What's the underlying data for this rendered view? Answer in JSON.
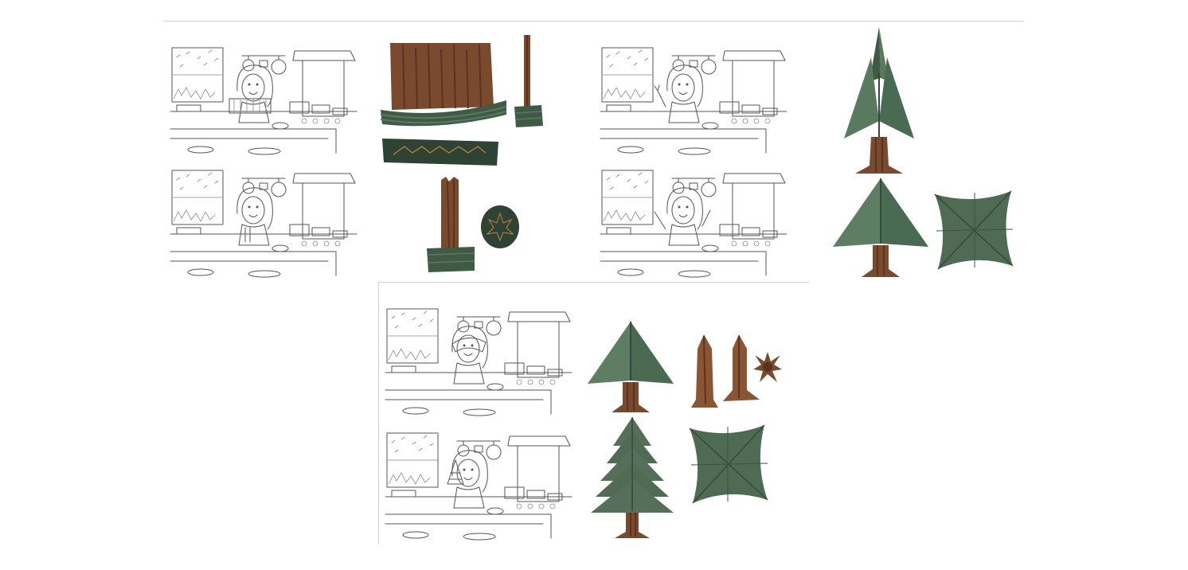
{
  "sheets": [
    {
      "id": "sheet-1",
      "panels": [
        "storyboard-pleat-front",
        "storyboard-pleat-side"
      ],
      "props": [
        "pleated-trunk-paper",
        "folded-base-strip",
        "tall-trunk-stick",
        "short-trunk-stick",
        "star-cut-circle"
      ]
    },
    {
      "id": "sheet-2",
      "panels": [
        "storyboard-wave",
        "storyboard-wave-both-hands"
      ],
      "props": [
        "tall-tree-model",
        "small-tree-model",
        "square-fold-base"
      ]
    },
    {
      "id": "sheet-3",
      "panels": [
        "storyboard-cover-eyes",
        "storyboard-hold-tree"
      ],
      "props": [
        "tree-cone",
        "split-trunk-pieces",
        "burst-star",
        "layered-tree",
        "square-fold-base-2"
      ]
    }
  ],
  "colors": {
    "trunk": "#7a4a2e",
    "trunk_dark": "#5a331e",
    "leaf": "#4f6b54",
    "leaf_dark": "#34493a",
    "line": "#555555",
    "rule": "#cfcfcf"
  }
}
